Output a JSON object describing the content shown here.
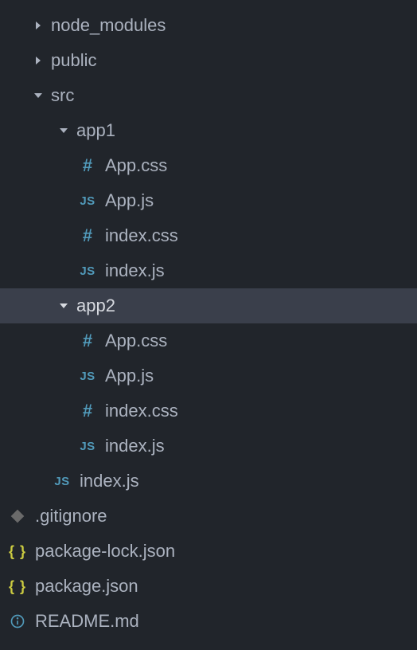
{
  "tree": [
    {
      "indent": 28,
      "type": "folder",
      "state": "collapsed",
      "label": "node_modules",
      "selected": false
    },
    {
      "indent": 28,
      "type": "folder",
      "state": "collapsed",
      "label": "public",
      "selected": false
    },
    {
      "indent": 28,
      "type": "folder",
      "state": "expanded",
      "label": "src",
      "selected": false
    },
    {
      "indent": 60,
      "type": "folder",
      "state": "expanded",
      "label": "app1",
      "selected": false
    },
    {
      "indent": 88,
      "type": "file",
      "icon": "css",
      "label": "App.css",
      "selected": false
    },
    {
      "indent": 88,
      "type": "file",
      "icon": "js",
      "label": "App.js",
      "selected": false
    },
    {
      "indent": 88,
      "type": "file",
      "icon": "css",
      "label": "index.css",
      "selected": false
    },
    {
      "indent": 88,
      "type": "file",
      "icon": "js",
      "label": "index.js",
      "selected": false
    },
    {
      "indent": 60,
      "type": "folder",
      "state": "expanded",
      "label": "app2",
      "selected": true
    },
    {
      "indent": 88,
      "type": "file",
      "icon": "css",
      "label": "App.css",
      "selected": false
    },
    {
      "indent": 88,
      "type": "file",
      "icon": "js",
      "label": "App.js",
      "selected": false
    },
    {
      "indent": 88,
      "type": "file",
      "icon": "css",
      "label": "index.css",
      "selected": false
    },
    {
      "indent": 88,
      "type": "file",
      "icon": "js",
      "label": "index.js",
      "selected": false
    },
    {
      "indent": 56,
      "type": "file",
      "icon": "js",
      "label": "index.js",
      "selected": false
    },
    {
      "indent": 0,
      "type": "file",
      "icon": "git",
      "label": ".gitignore",
      "selected": false
    },
    {
      "indent": 0,
      "type": "file",
      "icon": "json",
      "label": "package-lock.json",
      "selected": false
    },
    {
      "indent": 0,
      "type": "file",
      "icon": "json",
      "label": "package.json",
      "selected": false
    },
    {
      "indent": 0,
      "type": "file",
      "icon": "info",
      "label": "README.md",
      "selected": false
    }
  ]
}
